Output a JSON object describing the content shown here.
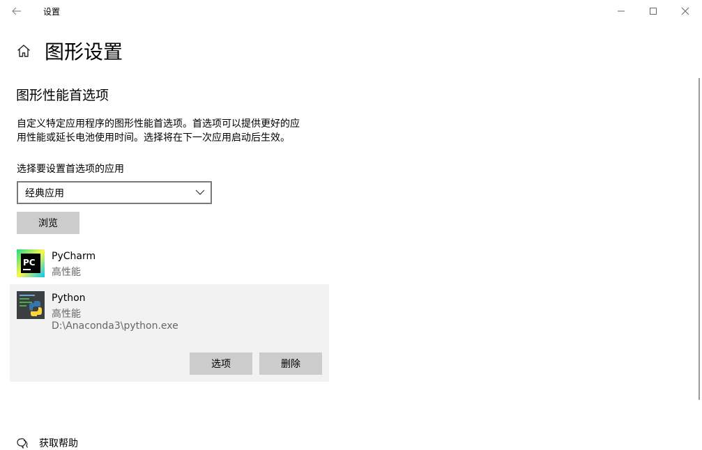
{
  "window": {
    "title": "设置",
    "back_icon": "back-arrow-icon",
    "minimize_icon": "minimize-icon",
    "maximize_icon": "maximize-icon",
    "close_icon": "close-icon"
  },
  "page": {
    "home_icon": "home-icon",
    "title": "图形设置"
  },
  "section": {
    "title": "图形性能首选项",
    "description_line1": "自定义特定应用程序的图形性能首选项。首选项可以提供更好的应",
    "description_line2": "用性能或延长电池使用时间。选择将在下一次应用启动后生效。",
    "select_label": "选择要设置首选项的应用"
  },
  "dropdown": {
    "value": "经典应用",
    "chevron_icon": "chevron-down-icon"
  },
  "browse_label": "浏览",
  "apps": [
    {
      "name": "PyCharm",
      "preference": "高性能",
      "icon": "pycharm-icon"
    },
    {
      "name": "Python",
      "preference": "高性能",
      "path": "D:\\Anaconda3\\python.exe",
      "icon": "python-icon",
      "selected": true,
      "options_label": "选项",
      "delete_label": "删除"
    }
  ],
  "help": {
    "label": "获取帮助",
    "icon": "help-chat-icon"
  },
  "colors": {
    "button_bg": "#cccccc",
    "selected_row_bg": "#f2f2f2",
    "secondary_text": "#666666"
  }
}
